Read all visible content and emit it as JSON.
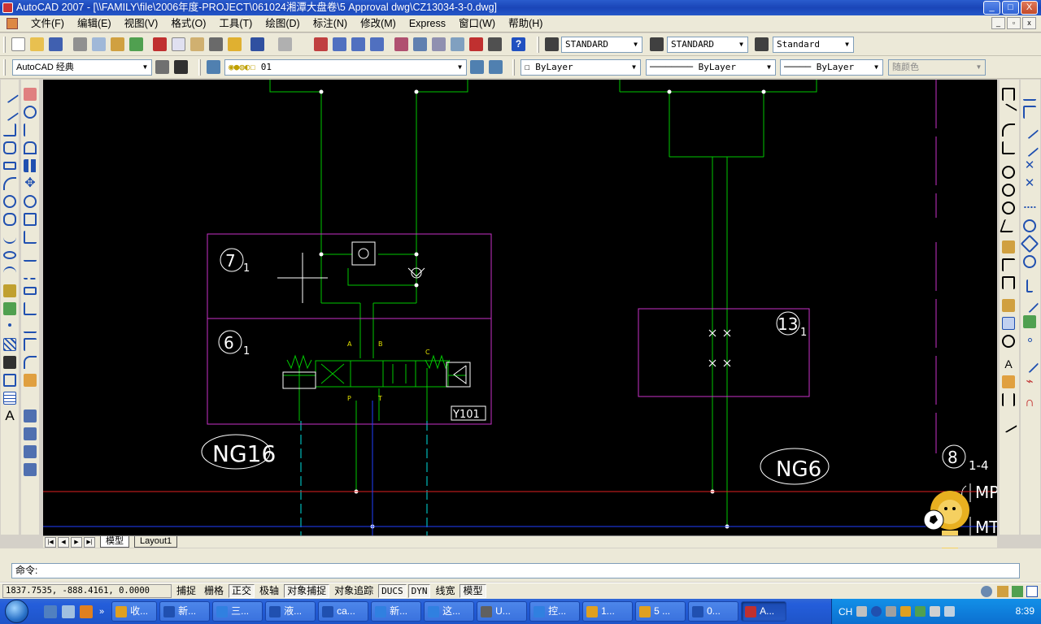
{
  "window": {
    "title": "AutoCAD 2007 - [\\\\FAMILY\\file\\2006年度-PROJECT\\061024湘潭大盘卷\\5 Approval dwg\\CZ13034-3-0.dwg]",
    "controls": [
      "_",
      "□",
      "X"
    ]
  },
  "menu": {
    "items": [
      "文件(F)",
      "编辑(E)",
      "视图(V)",
      "格式(O)",
      "工具(T)",
      "绘图(D)",
      "标注(N)",
      "修改(M)",
      "Express",
      "窗口(W)",
      "帮助(H)"
    ]
  },
  "toolbar1": {
    "text_style": "STANDARD",
    "dim_style": "STANDARD",
    "table_style": "Standard"
  },
  "toolbar2": {
    "workspace": "AutoCAD 经典",
    "layer": "01",
    "color": "ByLayer",
    "linetype": "ByLayer",
    "lineweight": "ByLayer",
    "plotstyle": "随颜色"
  },
  "drawing": {
    "label_7": "7",
    "label_7_sub": "1",
    "label_6": "6",
    "label_6_sub": "1",
    "label_13": "13",
    "label_13_sub": "1",
    "label_8": "8",
    "label_8_sub": "1-4",
    "valve_code": "Y101",
    "port_a": "A",
    "port_b": "B",
    "port_p": "P",
    "port_t": "T",
    "port_c": "C",
    "ng16": "NG16",
    "ng6": "NG6",
    "mp": "MP",
    "mt": "MT"
  },
  "tabs": {
    "model": "模型",
    "layout1": "Layout1"
  },
  "command": {
    "prompt": "命令:"
  },
  "status": {
    "coords": "1837.7535, -888.4161, 0.0000",
    "buttons": [
      {
        "label": "捕捉",
        "on": false
      },
      {
        "label": "栅格",
        "on": false
      },
      {
        "label": "正交",
        "on": true
      },
      {
        "label": "极轴",
        "on": false
      },
      {
        "label": "对象捕捉",
        "on": true
      },
      {
        "label": "对象追踪",
        "on": false
      },
      {
        "label": "DUCS",
        "on": true
      },
      {
        "label": "DYN",
        "on": true
      },
      {
        "label": "线宽",
        "on": false
      },
      {
        "label": "模型",
        "on": true
      }
    ]
  },
  "taskbar": {
    "tasks": [
      "收...",
      "新...",
      "三...",
      "液...",
      "ca...",
      "新...",
      "这...",
      "U...",
      "控...",
      "1...",
      "5 ...",
      "0...",
      "A..."
    ],
    "active_task": 12,
    "lang": "CH",
    "clock": "8:39"
  },
  "colors": {
    "canvas": "#000000",
    "green": "#00c800",
    "magenta": "#c832c8",
    "red": "#e02020",
    "blue": "#2040ff",
    "white": "#ffffff",
    "cyan": "#00e0e0"
  }
}
